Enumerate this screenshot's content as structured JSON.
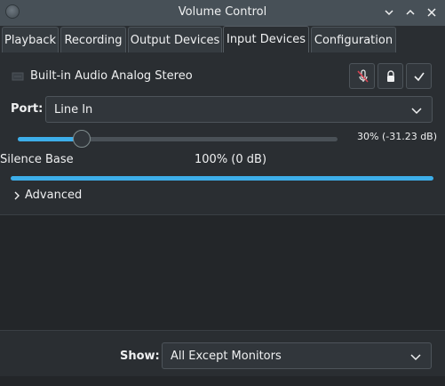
{
  "window": {
    "title": "Volume Control",
    "controls": [
      "chevron-down-icon",
      "chevron-up-icon",
      "close-icon"
    ]
  },
  "tabs": [
    {
      "label": "Playback",
      "active": false
    },
    {
      "label": "Recording",
      "active": false
    },
    {
      "label": "Output Devices",
      "active": false
    },
    {
      "label": "Input Devices",
      "active": true
    },
    {
      "label": "Configuration",
      "active": false
    }
  ],
  "device": {
    "name": "Built-in Audio Analog Stereo",
    "port_label": "Port:",
    "port_value": "Line In",
    "volume_percent": 30,
    "volume_text": "30% (-31.23 dB)",
    "silence_label": "Silence Base",
    "silence_value": "100% (0 dB)",
    "advanced_label": "Advanced",
    "buttons": [
      "mute-icon",
      "lock-icon",
      "checkmark-icon"
    ]
  },
  "footer": {
    "show_label": "Show:",
    "show_value": "All Except Monitors"
  },
  "colors": {
    "accent": "#3daee9",
    "background": "#2a2e32",
    "titlebar": "#475057",
    "mute_icon": "#da4453"
  }
}
